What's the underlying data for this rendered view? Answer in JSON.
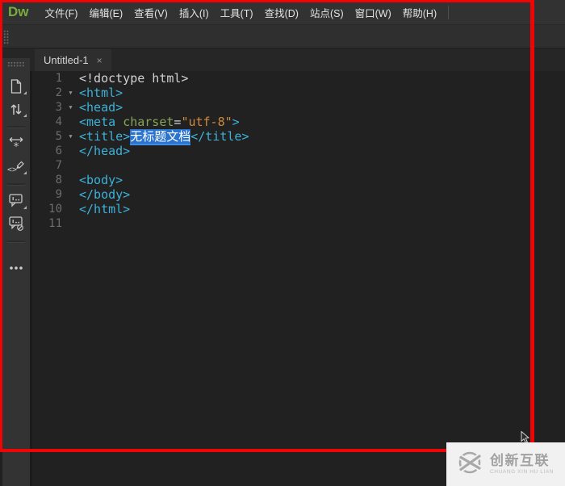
{
  "window": {
    "logo_text": "Dw",
    "menus": [
      "文件(F)",
      "编辑(E)",
      "查看(V)",
      "插入(I)",
      "工具(T)",
      "查找(D)",
      "站点(S)",
      "窗口(W)",
      "帮助(H)"
    ]
  },
  "tab": {
    "title": "Untitled-1",
    "close_glyph": "×"
  },
  "editor": {
    "fold_glyph": "▼",
    "lines": [
      {
        "num": "1",
        "fold": false,
        "tokens": [
          {
            "text": "<!doctype html>",
            "style": "plain"
          }
        ]
      },
      {
        "num": "2",
        "fold": true,
        "tokens": [
          {
            "text": "<html>",
            "style": "tag"
          }
        ]
      },
      {
        "num": "3",
        "fold": true,
        "tokens": [
          {
            "text": "<head>",
            "style": "tag"
          }
        ]
      },
      {
        "num": "4",
        "fold": false,
        "tokens": [
          {
            "text": "<meta ",
            "style": "tag"
          },
          {
            "text": "charset",
            "style": "attr"
          },
          {
            "text": "=",
            "style": "plain"
          },
          {
            "text": "\"utf-8\"",
            "style": "string"
          },
          {
            "text": ">",
            "style": "tag"
          }
        ]
      },
      {
        "num": "5",
        "fold": true,
        "tokens": [
          {
            "text": "<title>",
            "style": "tag"
          },
          {
            "text": "无标题文档",
            "style": "selection"
          },
          {
            "text": "</title>",
            "style": "tag"
          }
        ]
      },
      {
        "num": "6",
        "fold": false,
        "tokens": [
          {
            "text": "</head>",
            "style": "tag"
          }
        ]
      },
      {
        "num": "7",
        "fold": false,
        "tokens": []
      },
      {
        "num": "8",
        "fold": false,
        "tokens": [
          {
            "text": "<body>",
            "style": "tag"
          }
        ]
      },
      {
        "num": "9",
        "fold": false,
        "tokens": [
          {
            "text": "</body>",
            "style": "tag"
          }
        ]
      },
      {
        "num": "10",
        "fold": false,
        "tokens": [
          {
            "text": "</html>",
            "style": "tag"
          }
        ]
      },
      {
        "num": "11",
        "fold": false,
        "tokens": []
      }
    ]
  },
  "sidebar": {
    "items": [
      {
        "icon": "file-icon",
        "menu_arrow": true
      },
      {
        "icon": "updown-arrows-icon",
        "menu_arrow": true
      },
      {
        "divider": true
      },
      {
        "icon": "wrap-asterisk-icon",
        "menu_arrow": false
      },
      {
        "icon": "code-pencil-icon",
        "menu_arrow": true
      },
      {
        "divider": true
      },
      {
        "icon": "apply-comment-icon",
        "menu_arrow": true
      },
      {
        "icon": "remove-comment-icon",
        "menu_arrow": false
      },
      {
        "divider": true
      },
      {
        "icon": "more-options-icon",
        "menu_arrow": false
      }
    ]
  },
  "watermark": {
    "cn": "创新互联",
    "en": "CHUANG XIN HU LIAN"
  },
  "colors": {
    "annotation_red": "#ef0505",
    "logo_green": "#79ab3d",
    "code_tag": "#3eb1d8",
    "code_attribute": "#85a557",
    "code_string": "#ce8a3e",
    "code_plain": "#d2d2d2",
    "selection_blue": "#2a74d0",
    "watermark_bg": "#f1f1f1"
  }
}
